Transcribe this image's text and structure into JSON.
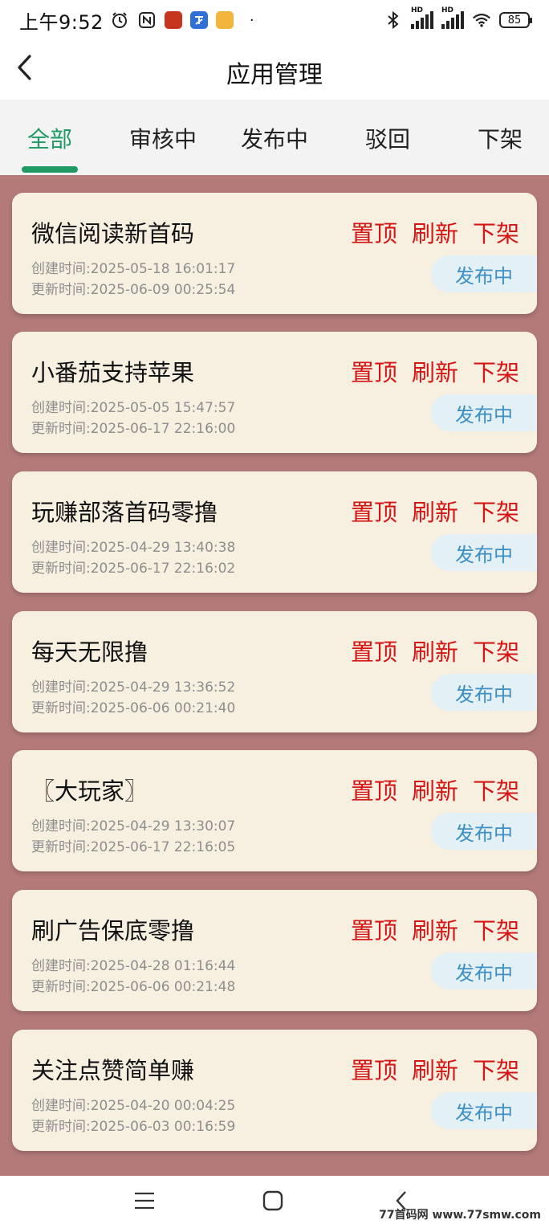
{
  "status_bar": {
    "time": "上午9:52",
    "battery": "85",
    "hd_label_1": "HD",
    "hd_label_2": "HD",
    "dot": "·"
  },
  "header": {
    "title": "应用管理"
  },
  "tabs": [
    {
      "label": "全部",
      "active": true
    },
    {
      "label": "审核中",
      "active": false
    },
    {
      "label": "发布中",
      "active": false
    },
    {
      "label": "驳回",
      "active": false
    },
    {
      "label": "下架",
      "active": false
    }
  ],
  "actions": {
    "pin": "置顶",
    "refresh": "刷新",
    "takedown": "下架"
  },
  "items": [
    {
      "title": "微信阅读新首码",
      "created": "创建时间:2025-05-18 16:01:17",
      "updated": "更新时间:2025-06-09 00:25:54",
      "status": "发布中"
    },
    {
      "title": "小番茄支持苹果",
      "created": "创建时间:2025-05-05 15:47:57",
      "updated": "更新时间:2025-06-17 22:16:00",
      "status": "发布中"
    },
    {
      "title": "玩赚部落首码零撸",
      "created": "创建时间:2025-04-29 13:40:38",
      "updated": "更新时间:2025-06-17 22:16:02",
      "status": "发布中"
    },
    {
      "title": "每天无限撸",
      "created": "创建时间:2025-04-29 13:36:52",
      "updated": "更新时间:2025-06-06 00:21:40",
      "status": "发布中"
    },
    {
      "title": "〖大玩家〗",
      "created": "创建时间:2025-04-29 13:30:07",
      "updated": "更新时间:2025-06-17 22:16:05",
      "status": "发布中"
    },
    {
      "title": "刷广告保底零撸",
      "created": "创建时间:2025-04-28 01:16:44",
      "updated": "更新时间:2025-06-06 00:21:48",
      "status": "发布中"
    },
    {
      "title": "关注点赞简单赚",
      "created": "创建时间:2025-04-20 00:04:25",
      "updated": "更新时间:2025-06-03 00:16:59",
      "status": "发布中"
    }
  ],
  "watermark": "77首码网 www.77smw.com",
  "colors": {
    "accent_green": "#1f9a64",
    "action_red": "#d41616",
    "status_blue": "#3d8fc4",
    "list_bg": "#b47a7a",
    "card_bg": "#f7f0e1"
  }
}
